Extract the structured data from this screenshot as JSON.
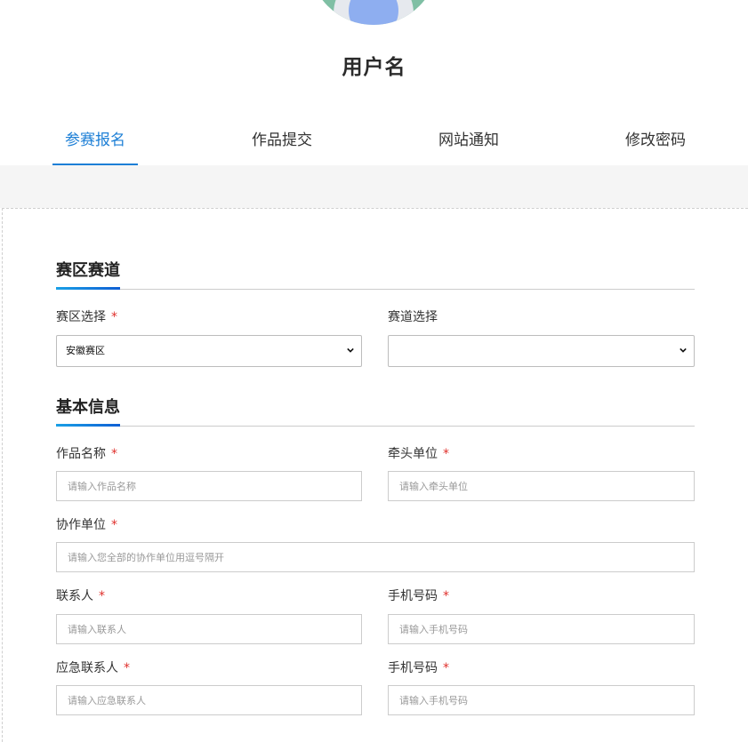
{
  "profile": {
    "username": "用户名"
  },
  "tabs": [
    {
      "label": "参赛报名",
      "active": true
    },
    {
      "label": "作品提交",
      "active": false
    },
    {
      "label": "网站通知",
      "active": false
    },
    {
      "label": "修改密码",
      "active": false
    }
  ],
  "sections": {
    "division": "赛区赛道",
    "basic": "基本信息"
  },
  "fields": {
    "region": {
      "label": "赛区选择",
      "required": "*",
      "value": "安徽赛区"
    },
    "track": {
      "label": "赛道选择",
      "value": ""
    },
    "work_name": {
      "label": "作品名称",
      "required": "*",
      "placeholder": "请输入作品名称"
    },
    "lead_unit": {
      "label": "牵头单位",
      "required": "*",
      "placeholder": "请输入牵头单位"
    },
    "co_units": {
      "label": "协作单位",
      "required": "*",
      "placeholder": "请输入您全部的协作单位用逗号隔开"
    },
    "contact": {
      "label": "联系人",
      "required": "*",
      "placeholder": "请输入联系人"
    },
    "contact_phone": {
      "label": "手机号码",
      "required": "*",
      "placeholder": "请输入手机号码"
    },
    "emergency_contact": {
      "label": "应急联系人",
      "required": "*",
      "placeholder": "请输入应急联系人"
    },
    "emergency_phone": {
      "label": "手机号码",
      "required": "*",
      "placeholder": "请输入手机号码"
    }
  },
  "colors": {
    "accent": "#1d7fd6",
    "required": "#e0302c"
  }
}
